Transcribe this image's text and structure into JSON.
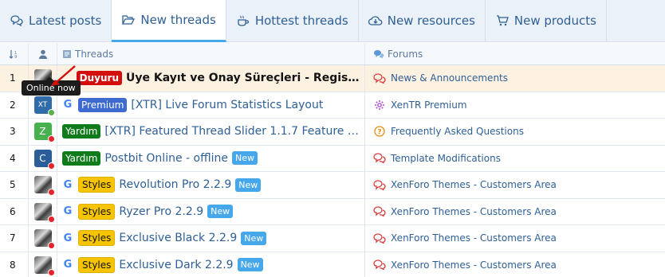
{
  "tabs": [
    {
      "label": "Latest posts",
      "icon": "comments-icon",
      "active": false
    },
    {
      "label": "New threads",
      "icon": "folder-open-icon",
      "active": true
    },
    {
      "label": "Hottest threads",
      "icon": "coffee-icon",
      "active": false
    },
    {
      "label": "New resources",
      "icon": "cloud-download-icon",
      "active": false
    },
    {
      "label": "New products",
      "icon": "cart-icon",
      "active": false
    }
  ],
  "header": {
    "threads": "Threads",
    "forums": "Forums"
  },
  "tooltip": "Online now",
  "rows": [
    {
      "num": "1",
      "avatar": "photo",
      "status": "red",
      "prefix": "Duyuru",
      "prefix_color": "red",
      "title": "Üye Kayıt ve Onay Süreçleri - Registratio...",
      "bold": true,
      "new": false,
      "forum": "News & Announcements",
      "forum_icon": "comments-icon",
      "google": false
    },
    {
      "num": "2",
      "avatar": "XT",
      "status": "green",
      "prefix": "Premium",
      "prefix_color": "blue",
      "title": "[XTR] Live Forum Statistics Layout",
      "bold": false,
      "new": false,
      "forum": "XenTR Premium",
      "forum_icon": "gear-icon",
      "google": true
    },
    {
      "num": "3",
      "avatar": "Z",
      "status": "red",
      "prefix": "Yardım",
      "prefix_color": "green",
      "title": "[XTR] Featured Thread Slider 1.1.7 Feature b...",
      "bold": false,
      "new": false,
      "forum": "Frequently Asked Questions",
      "forum_icon": "question-icon",
      "google": false
    },
    {
      "num": "4",
      "avatar": "C",
      "status": "red",
      "prefix": "Yardım",
      "prefix_color": "green",
      "title": "Postbit Online - offline",
      "bold": false,
      "new": true,
      "forum": "Template Modifications",
      "forum_icon": "comments-icon",
      "google": false
    },
    {
      "num": "5",
      "avatar": "photo",
      "status": "red",
      "prefix": "Styles",
      "prefix_color": "yellow",
      "title": "Revolution Pro 2.2.9",
      "bold": false,
      "new": true,
      "forum": "XenForo Themes - Customers Area",
      "forum_icon": "comments-icon",
      "google": true
    },
    {
      "num": "6",
      "avatar": "photo",
      "status": "red",
      "prefix": "Styles",
      "prefix_color": "yellow",
      "title": "Ryzer Pro 2.2.9",
      "bold": false,
      "new": true,
      "forum": "XenForo Themes - Customers Area",
      "forum_icon": "comments-icon",
      "google": true
    },
    {
      "num": "7",
      "avatar": "photo",
      "status": "red",
      "prefix": "Styles",
      "prefix_color": "yellow",
      "title": "Exclusive Black 2.2.9",
      "bold": false,
      "new": true,
      "forum": "XenForo Themes - Customers Area",
      "forum_icon": "comments-icon",
      "google": true
    },
    {
      "num": "8",
      "avatar": "photo",
      "status": "red",
      "prefix": "Styles",
      "prefix_color": "yellow",
      "title": "Exclusive Dark 2.2.9",
      "bold": false,
      "new": true,
      "forum": "XenForo Themes - Customers Area",
      "forum_icon": "comments-icon",
      "google": true
    }
  ],
  "new_label": "New",
  "google_glyph": "G",
  "colors": {
    "accent": "#47a7eb",
    "link": "#2e5f95",
    "highlight_row": "#fdf1e2"
  }
}
